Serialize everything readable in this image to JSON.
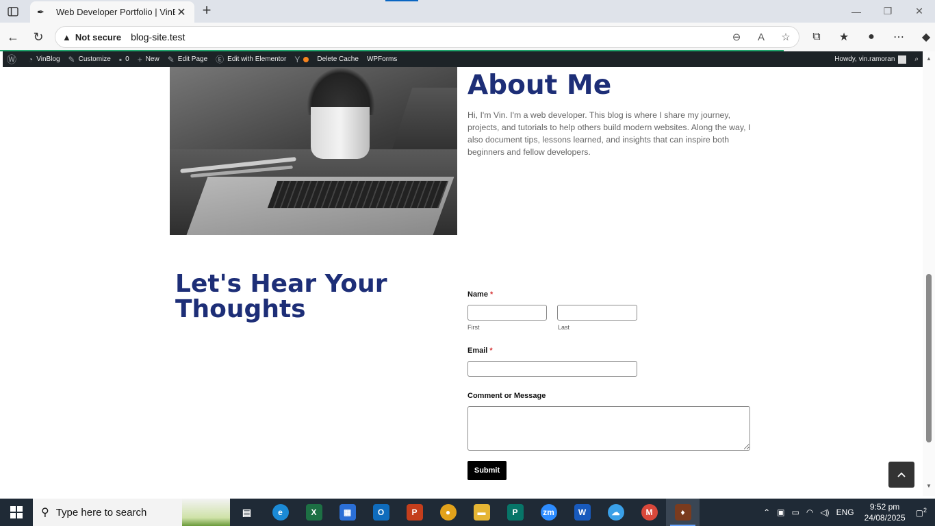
{
  "browser": {
    "tab_title": "Web Developer Portfolio | VinBlog",
    "security_label": "Not secure",
    "url": "blog-site.test"
  },
  "adminbar": {
    "site_name": "VinBlog",
    "customize": "Customize",
    "comments_count": "0",
    "new": "New",
    "edit_page": "Edit Page",
    "edit_elementor": "Edit with Elementor",
    "delete_cache": "Delete Cache",
    "wpforms": "WPForms",
    "howdy": "Howdy, vin.ramoran"
  },
  "about": {
    "title": "About Me",
    "text": "Hi, I'm Vin. I'm a web developer. This blog is where I share my journey, projects, and tutorials to help others build modern websites. Along the way, I also document tips, lessons learned, and insights that can inspire both beginners and fellow developers."
  },
  "contact": {
    "title": "Let's Hear Your Thoughts",
    "name_label": "Name",
    "required_mark": "*",
    "first_sublabel": "First",
    "last_sublabel": "Last",
    "first_value": "",
    "last_value": "",
    "email_label": "Email",
    "email_value": "",
    "message_label": "Comment or Message",
    "message_value": "",
    "submit_label": "Submit"
  },
  "taskbar": {
    "search_placeholder": "Type here to search",
    "language": "ENG",
    "time": "9:52 pm",
    "date": "24/08/2025",
    "notification_count": "2"
  },
  "colors": {
    "heading": "#1d2e77",
    "adminbar": "#1d2327",
    "required": "#d63637",
    "progress": "#1ea36b"
  }
}
